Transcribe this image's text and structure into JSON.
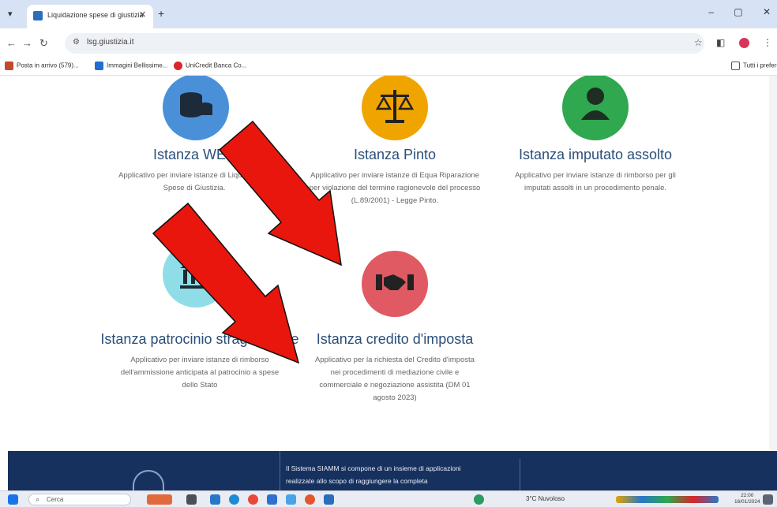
{
  "browser": {
    "tab_title": "Liquidazione spese di giustizia",
    "url": "lsg.giustizia.it",
    "bookmarks": [
      "Posta in arrivo (579)...",
      "Immagini Bellissime...",
      "UniCredit Banca Co..."
    ],
    "all_bookmarks": "Tutti i preferiti"
  },
  "cards": [
    {
      "title": "Istanza WEB",
      "desc": [
        "Applicativo per inviare istanze di Liquidazione",
        "Spese di Giustizia."
      ],
      "icon": "database-icon",
      "color": "#4a90d9"
    },
    {
      "title": "Istanza Pinto",
      "desc": [
        "Applicativo per inviare istanze di Equa Riparazione",
        "per violazione del termine ragionevole del processo",
        "(L.89/2001) - Legge Pinto."
      ],
      "icon": "scales-icon",
      "color": "#f0a400"
    },
    {
      "title": "Istanza imputato assolto",
      "desc": [
        "Applicativo per inviare istanze di rimborso per gli",
        "imputati assolti in un procedimento penale."
      ],
      "icon": "person-icon",
      "color": "#2fa84f"
    },
    {
      "title": "Istanza patrocinio stragiudiziale",
      "desc": [
        "Applicativo per inviare istanze di rimborso",
        "dell'ammissione anticipata al patrocinio a spese",
        "dello Stato"
      ],
      "icon": "bank-icon",
      "color": "#8fdde6"
    },
    {
      "title": "Istanza credito d'imposta",
      "desc": [
        "Applicativo per la richiesta del Credito d'imposta",
        "nei procedimenti di mediazione civile e",
        "commerciale e negoziazione assistita (DM 01",
        "agosto 2023)"
      ],
      "icon": "handshake-icon",
      "color": "#e05a64"
    }
  ],
  "footer": {
    "text": [
      "Il Sistema SIAMM si compone di un insieme di applicazioni",
      "realizzate allo scopo di raggiungere la completa"
    ]
  },
  "taskbar": {
    "search_placeholder": "Cerca",
    "weather": "3°C Nuvoloso",
    "time": "22:00",
    "date": "16/01/2024"
  },
  "colors": {
    "accent": "#2a4f7a",
    "footer": "#17315f",
    "arrow": "#e8160c"
  }
}
